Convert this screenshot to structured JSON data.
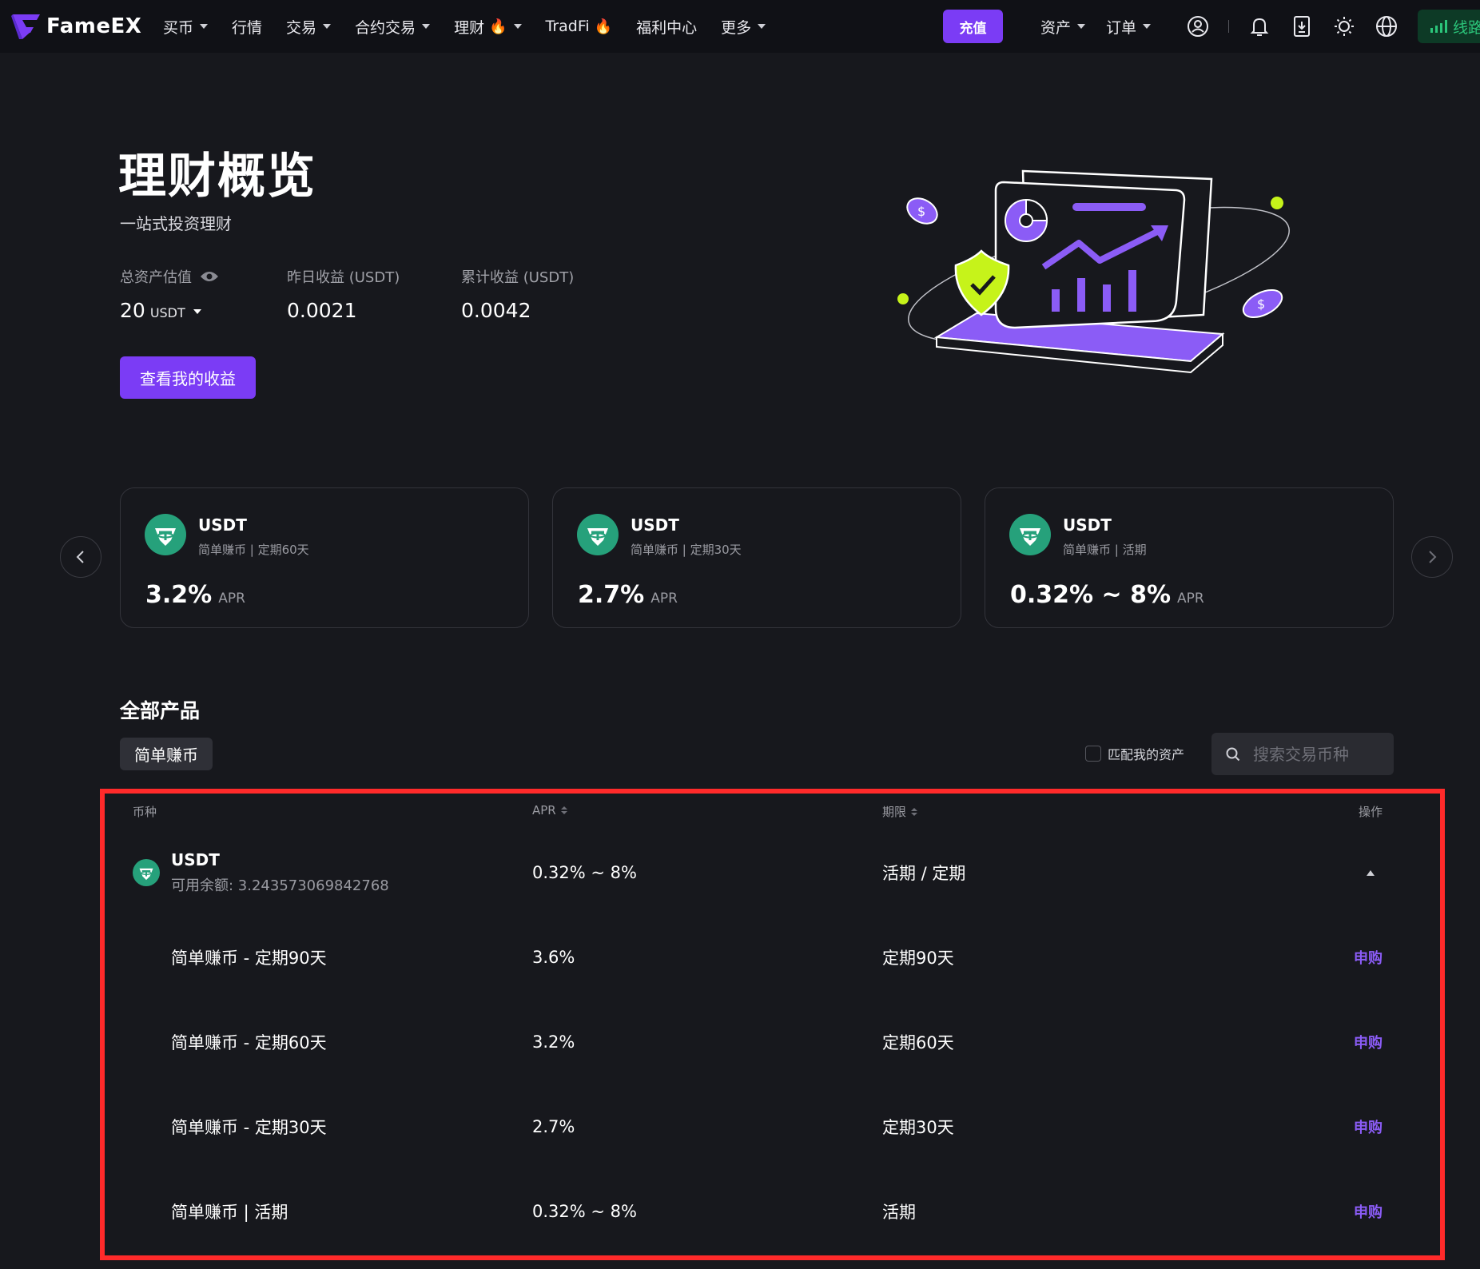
{
  "brand": {
    "name": "FameEX",
    "accent": "#7b3cf5",
    "line_green": "#2bc57a",
    "highlight_red": "#ff2a2a"
  },
  "nav": {
    "menu": [
      {
        "label": "买币",
        "dropdown": true,
        "flame": false
      },
      {
        "label": "行情",
        "dropdown": false,
        "flame": false
      },
      {
        "label": "交易",
        "dropdown": true,
        "flame": false
      },
      {
        "label": "合约交易",
        "dropdown": true,
        "flame": false
      },
      {
        "label": "理财",
        "dropdown": true,
        "flame": true
      },
      {
        "label": "TradFi",
        "dropdown": false,
        "flame": true
      },
      {
        "label": "福利中心",
        "dropdown": false,
        "flame": false
      },
      {
        "label": "更多",
        "dropdown": true,
        "flame": false
      }
    ],
    "deposit_label": "充值",
    "right_menu": [
      {
        "label": "资产",
        "dropdown": true
      },
      {
        "label": "订单",
        "dropdown": true
      }
    ],
    "icons": [
      "user-icon",
      "bell-icon",
      "download-icon",
      "theme-sun-icon",
      "globe-icon"
    ],
    "line_label": "线路"
  },
  "hero": {
    "title": "理财概览",
    "subtitle": "一站式投资理财",
    "stats": {
      "total": {
        "label": "总资产估值",
        "value": "20",
        "unit": "USDT"
      },
      "yesterday": {
        "label": "昨日收益 (USDT)",
        "value": "0.0021"
      },
      "cumulative": {
        "label": "累计收益 (USDT)",
        "value": "0.0042"
      }
    },
    "button_label": "查看我的收益"
  },
  "cards": [
    {
      "coin": "USDT",
      "desc": "简单赚币 | 定期60天",
      "rate": "3.2%",
      "apr": "APR"
    },
    {
      "coin": "USDT",
      "desc": "简单赚币 | 定期30天",
      "rate": "2.7%",
      "apr": "APR"
    },
    {
      "coin": "USDT",
      "desc": "简单赚币 | 活期",
      "rate": "0.32% ~ 8%",
      "apr": "APR"
    }
  ],
  "products": {
    "title": "全部产品",
    "tab": "简单赚币",
    "match_label": "匹配我的资产",
    "search_placeholder": "搜索交易币种",
    "headers": {
      "coin": "币种",
      "apr": "APR",
      "term": "期限",
      "action": "操作"
    },
    "main_row": {
      "coin": "USDT",
      "balance_label": "可用余额: 3.243573069842768",
      "apr": "0.32% ~ 8%",
      "term": "活期 / 定期"
    },
    "rows": [
      {
        "name": "简单赚币 - 定期90天",
        "apr": "3.6%",
        "term": "定期90天",
        "action": "申购"
      },
      {
        "name": "简单赚币 - 定期60天",
        "apr": "3.2%",
        "term": "定期60天",
        "action": "申购"
      },
      {
        "name": "简单赚币 - 定期30天",
        "apr": "2.7%",
        "term": "定期30天",
        "action": "申购"
      },
      {
        "name": "简单赚币 | 活期",
        "apr": "0.32% ~ 8%",
        "term": "活期",
        "action": "申购"
      }
    ]
  }
}
